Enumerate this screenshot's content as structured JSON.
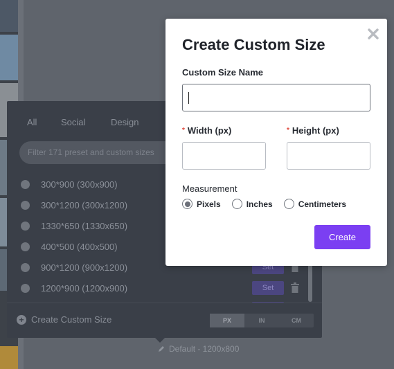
{
  "modal": {
    "title": "Create Custom Size",
    "name_label": "Custom Size Name",
    "name_value": "",
    "width_label": "Width (px)",
    "height_label": "Height (px)",
    "required_mark": "*",
    "width_value": "",
    "height_value": "",
    "measurement_label": "Measurement",
    "measurement_options": [
      "Pixels",
      "Inches",
      "Centimeters"
    ],
    "measurement_selected": "Pixels",
    "create_label": "Create",
    "close_icon": "close-icon"
  },
  "size_panel": {
    "tabs": [
      "All",
      "Social",
      "Design"
    ],
    "filter_placeholder": "Filter 171 preset and custom sizes",
    "presets": [
      "300*900 (300x900)",
      "300*1200 (300x1200)",
      "1330*650 (1330x650)",
      "400*500 (400x500)",
      "900*1200 (900x1200)",
      "1200*900 (1200x900)"
    ],
    "set_label": "Set",
    "create_custom_label": "Create Custom Size",
    "units": [
      "PX",
      "IN",
      "CM"
    ],
    "active_unit": "PX",
    "default_label": "Default - 1200x800"
  },
  "colors": {
    "accent": "#7b3ff2",
    "overlay": "#5f646c"
  }
}
